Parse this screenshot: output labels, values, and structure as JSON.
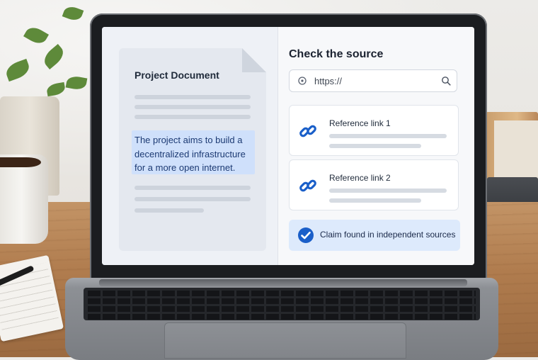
{
  "document": {
    "title": "Project Document",
    "highlighted_text": "The project aims to build a decentralized infrastructure for a more open internet."
  },
  "source_panel": {
    "heading": "Check the source",
    "url_value": "https://",
    "references": [
      {
        "label": "Reference link 1",
        "icon": "link-icon"
      },
      {
        "label": "Reference link 2",
        "icon": "link-icon"
      }
    ],
    "status": {
      "text": "Claim found in independent sources",
      "icon": "check-circle-icon"
    }
  },
  "colors": {
    "accent": "#1a5fc9",
    "highlight": "#cfe0fb",
    "status_bg": "#ddeafc"
  }
}
